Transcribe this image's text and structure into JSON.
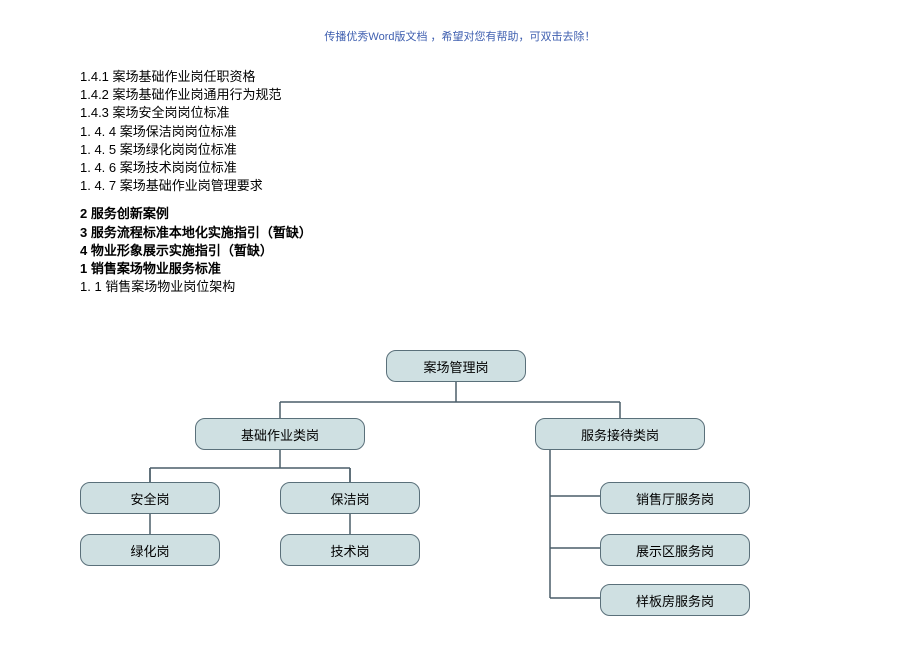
{
  "header": {
    "note": "传播优秀Word版文档 ，希望对您有帮助，可双击去除！"
  },
  "toc": {
    "l141": "1.4.1 案场基础作业岗任职资格",
    "l142": "1.4.2 案场基础作业岗通用行为规范",
    "l143": "1.4.3 案场安全岗岗位标准",
    "l144": "1. 4. 4 案场保洁岗岗位标准",
    "l145": "1. 4. 5 案场绿化岗岗位标准",
    "l146": "1. 4. 6 案场技术岗岗位标准",
    "l147": "1. 4. 7 案场基础作业岗管理要求",
    "l2": "2 服务创新案例",
    "l3": "3 服务流程标准本地化实施指引（暂缺）",
    "l4": "4 物业形象展示实施指引（暂缺）",
    "l1b": "1 销售案场物业服务标准",
    "l11": "1. 1 销售案场物业岗位架构"
  },
  "chart_data": {
    "type": "diagram",
    "title": "销售案场物业岗位架构",
    "nodes": {
      "root": {
        "label": "案场管理岗"
      },
      "base": {
        "label": "基础作业类岗"
      },
      "serv": {
        "label": "服务接待类岗"
      },
      "sec": {
        "label": "安全岗"
      },
      "clean": {
        "label": "保洁岗"
      },
      "green": {
        "label": "绿化岗"
      },
      "tech": {
        "label": "技术岗"
      },
      "hall": {
        "label": "销售厅服务岗"
      },
      "disp": {
        "label": "展示区服务岗"
      },
      "model": {
        "label": "样板房服务岗"
      }
    }
  }
}
